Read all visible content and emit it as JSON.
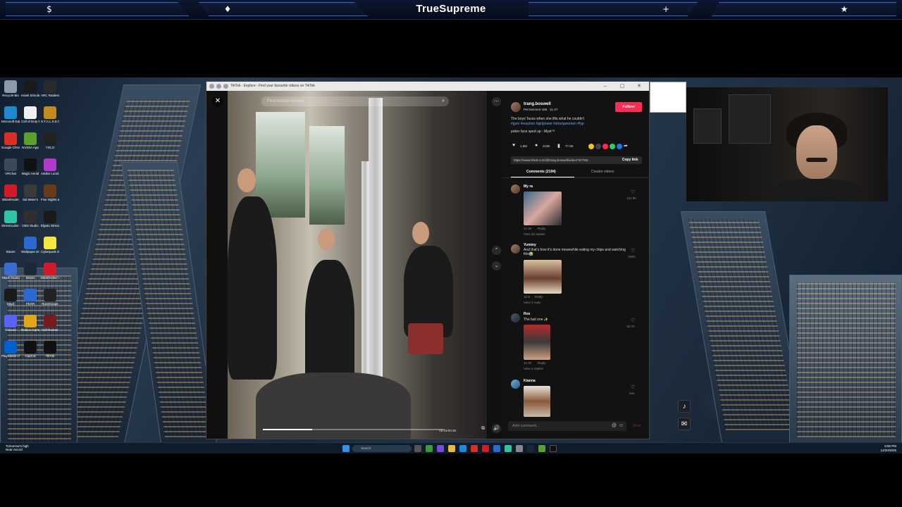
{
  "overlay": {
    "title": "TrueSupreme",
    "icons": [
      "$",
      "♦",
      "+",
      "★"
    ]
  },
  "desktop_icons": [
    {
      "label": "Recycle Bin",
      "color": "#8a9aa8"
    },
    {
      "label": "Hawk Simula...",
      "color": "#1a1a1a"
    },
    {
      "label": "ARC Raiders",
      "color": "#2a2a2a"
    },
    {
      "label": "Microsoft Edge",
      "color": "#1f8ad2"
    },
    {
      "label": "Call of Duty Modern...",
      "color": "#f0f0f0"
    },
    {
      "label": "S.T.A.L.K.E.R. 2 Heart of...",
      "color": "#c48a1c"
    },
    {
      "label": "Google Chrome",
      "color": "#d93025"
    },
    {
      "label": "NVIDIA App",
      "color": "#5aa02c"
    },
    {
      "label": "YOLO",
      "color": "#222"
    },
    {
      "label": "VRChat",
      "color": "#3a4a5a"
    },
    {
      "label": "Magic Aerial",
      "color": "#111"
    },
    {
      "label": "Adobe Lucid...",
      "color": "#b03ad0"
    },
    {
      "label": "BitDefender",
      "color": "#d11a2a"
    },
    {
      "label": "Sid Meier's",
      "color": "#3a3a3a"
    },
    {
      "label": "Five Nights at Freddy's",
      "color": "#6a3a1a"
    },
    {
      "label": "StreamLabs Desktop",
      "color": "#31c3a2"
    },
    {
      "label": "OBS Studio",
      "color": "#302e31"
    },
    {
      "label": "Elgato Stream Deck",
      "color": "#1a1a1a"
    },
    {
      "label": "Steam",
      "color": "#1b2838"
    },
    {
      "label": "Wallpaper Engine",
      "color": "#2a6ad0"
    },
    {
      "label": "Cyberpunk 2077",
      "color": "#f4e542"
    },
    {
      "label": "Tiktok Studio",
      "color": "#3b6cd0"
    },
    {
      "label": "Steam",
      "color": "#1b2838"
    },
    {
      "label": "Bitdefender VPN",
      "color": "#d11a2a"
    },
    {
      "label": "DayZ",
      "color": "#1a1a1a"
    },
    {
      "label": "FEAR",
      "color": "#2a6ad0"
    },
    {
      "label": "RuneScape",
      "color": "#222"
    },
    {
      "label": "Discord",
      "color": "#5865f2"
    },
    {
      "label": "Roblox Game...",
      "color": "#e2a51a"
    },
    {
      "label": "Hell Runner",
      "color": "#7a1a1a"
    },
    {
      "label": "PlayStation Accessories",
      "color": "#0060d0"
    },
    {
      "label": "CapCut",
      "color": "#111"
    },
    {
      "label": "TikTok",
      "color": "#111"
    }
  ],
  "browser": {
    "title": "TikTok - Explore - Find your favourite videos on TikTok"
  },
  "video": {
    "search_placeholder": "Find related content",
    "timecode": "00:24/00:38",
    "progress": 0.27
  },
  "post": {
    "username": "trang.boswell",
    "subtitle": "Pet Moment·186 · 11-27",
    "follow_label": "Follow",
    "caption": "The boys' faces when she lifts what he couldn't",
    "hashtags": "#gym #reaction #girlpower #strongwomen #fyp",
    "music": "poker face sped up - Myst™",
    "likes": "1.6M",
    "comments": "2195",
    "saves": "77.5K",
    "link": "https://www.tiktok.com/@trang.boswell/video/757766...",
    "copy_link_label": "Copy link",
    "tab_comments": "Comments (2194)",
    "tab_creator": "Creator videos"
  },
  "comments": [
    {
      "author": "My ra",
      "text": "",
      "meta": "11-30",
      "reply": "Reply",
      "view": "View 45 replies",
      "likes": "121.8K"
    },
    {
      "author": "Yummy",
      "text": "And that's how it's done meanwhile eating my chips and watching this😭",
      "meta": "12-9",
      "reply": "Reply",
      "view": "View 1 reply",
      "likes": "1946"
    },
    {
      "author": "Rox",
      "text": "The last one ✨",
      "meta": "11-30",
      "reply": "Reply",
      "view": "View 4 replies",
      "likes": "15.7K"
    },
    {
      "author": "Kianna",
      "text": "",
      "meta": "",
      "reply": "",
      "view": "",
      "likes": "231"
    }
  ],
  "comment_input_placeholder": "Add comment...",
  "post_label": "Post",
  "taskbar": {
    "weather_title": "Tomorrow's high",
    "weather_sub": "Near record",
    "search": "Search",
    "time": "8:50 PM",
    "date": "12/20/2025"
  }
}
